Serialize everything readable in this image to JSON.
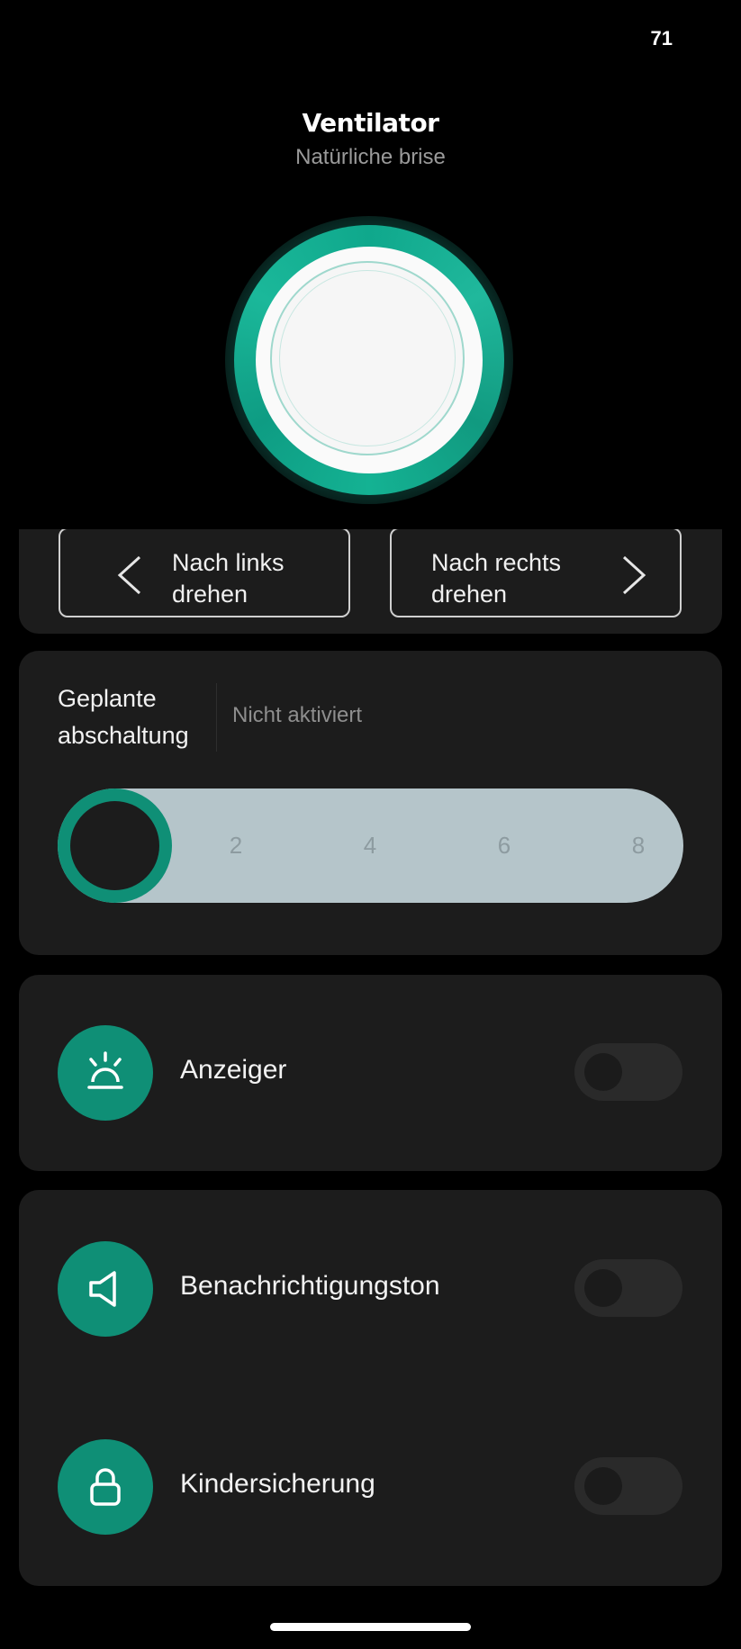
{
  "status_bar": {
    "battery": "71"
  },
  "header": {
    "title": "Ventilator",
    "subtitle": "Natürliche brise"
  },
  "rotation": {
    "left_label": "Nach links drehen",
    "right_label": "Nach rechts drehen"
  },
  "timer": {
    "label": "Geplante abschaltung",
    "status": "Nicht aktiviert",
    "ticks": [
      "2",
      "4",
      "6",
      "8"
    ],
    "value": 0
  },
  "indicator": {
    "label": "Anzeiger",
    "icon": "alarm-light-icon",
    "enabled": false
  },
  "notification_sound": {
    "label": "Benachrichtigungston",
    "icon": "speaker-icon",
    "enabled": false
  },
  "child_lock": {
    "label": "Kindersicherung",
    "icon": "lock-icon",
    "enabled": false
  },
  "colors": {
    "accent": "#0f8f76",
    "card": "#1c1c1c",
    "track": "#b5c5ca"
  }
}
